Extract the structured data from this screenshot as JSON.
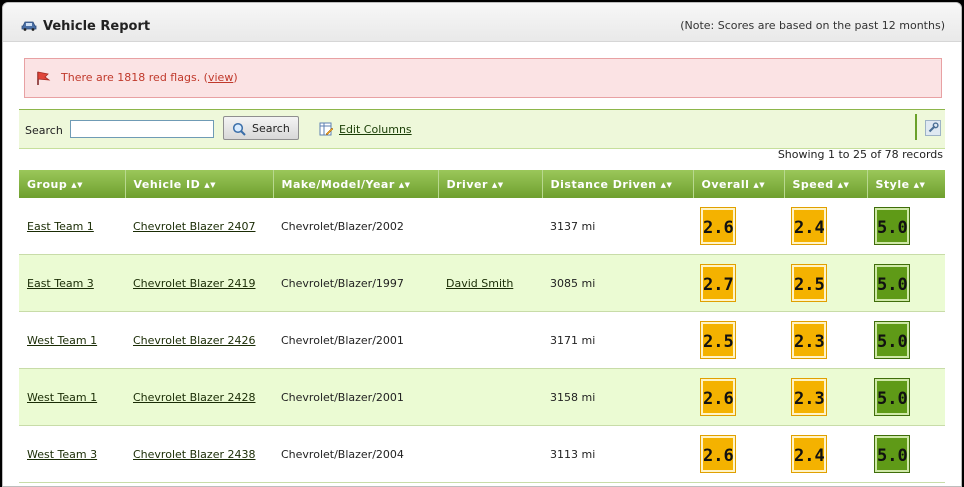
{
  "header": {
    "title": "Vehicle Report",
    "note": "(Note: Scores are based on the past 12 months)"
  },
  "alert": {
    "text_before": "There are 1818 red flags. (",
    "link": "view",
    "text_after": ")"
  },
  "toolbar": {
    "search_label": "Search",
    "search_value": "",
    "search_button": "Search",
    "edit_columns": "Edit Columns"
  },
  "records_text": "Showing 1 to 25 of 78 records",
  "table": {
    "columns": [
      "Group",
      "Vehicle ID",
      "Make/Model/Year",
      "Driver",
      "Distance Driven",
      "Overall",
      "Speed",
      "Style"
    ],
    "rows": [
      {
        "group": "East Team 1",
        "vehicle": "Chevrolet Blazer 2407",
        "make": "Chevrolet/Blazer/2002",
        "driver": "",
        "distance": "3137 mi",
        "overall": "2.6",
        "speed": "2.4",
        "style": "5.0"
      },
      {
        "group": "East Team 3",
        "vehicle": "Chevrolet Blazer 2419",
        "make": "Chevrolet/Blazer/1997",
        "driver": "David Smith",
        "distance": "3085 mi",
        "overall": "2.7",
        "speed": "2.5",
        "style": "5.0"
      },
      {
        "group": "West Team 1",
        "vehicle": "Chevrolet Blazer 2426",
        "make": "Chevrolet/Blazer/2001",
        "driver": "",
        "distance": "3171 mi",
        "overall": "2.5",
        "speed": "2.3",
        "style": "5.0"
      },
      {
        "group": "West Team 1",
        "vehicle": "Chevrolet Blazer 2428",
        "make": "Chevrolet/Blazer/2001",
        "driver": "",
        "distance": "3158 mi",
        "overall": "2.6",
        "speed": "2.3",
        "style": "5.0"
      },
      {
        "group": "West Team 3",
        "vehicle": "Chevrolet Blazer 2438",
        "make": "Chevrolet/Blazer/2004",
        "driver": "",
        "distance": "3113 mi",
        "overall": "2.6",
        "speed": "2.4",
        "style": "5.0"
      }
    ]
  },
  "colors": {
    "score_orange": "#f4b200",
    "score_green": "#5f9a17",
    "header_green": "#7aab36",
    "alert_red": "#c0392b"
  },
  "icons": [
    "car-icon",
    "red-flag-icon",
    "magnifier-icon",
    "edit-columns-icon",
    "wrench-icon",
    "sort-arrows-icon"
  ]
}
